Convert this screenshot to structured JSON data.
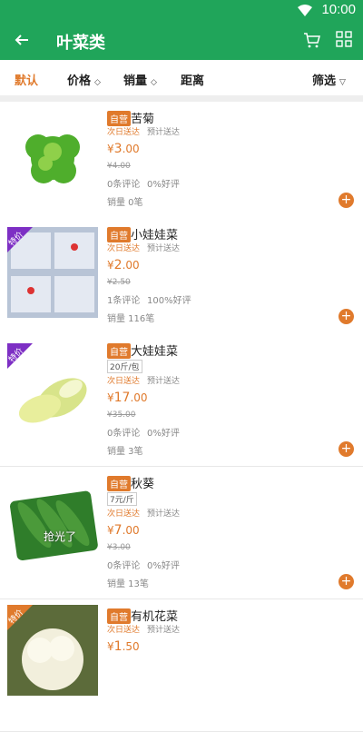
{
  "status": {
    "time": "10:00"
  },
  "header": {
    "title": "叶菜类"
  },
  "filters": {
    "default": "默认",
    "price": "价格",
    "sales": "销量",
    "distance": "距离",
    "filter": "筛选"
  },
  "products": [
    {
      "badge": "自营",
      "name": "苦菊",
      "spec": "",
      "delivery": "次日送达",
      "ship": "预计送达",
      "currency": "¥",
      "price_int": "3",
      "price_dec": ".00",
      "orig": "¥4.00",
      "comments": "0条评论",
      "good": "0%好评",
      "sold": "销量 0笔",
      "tag": "",
      "soldout": ""
    },
    {
      "badge": "自营",
      "name": "小娃娃菜",
      "spec": "",
      "delivery": "次日送达",
      "ship": "预计送达",
      "currency": "¥",
      "price_int": "2",
      "price_dec": ".00",
      "orig": "¥2.50",
      "comments": "1条评论",
      "good": "100%好评",
      "sold": "销量 116笔",
      "tag": "特价",
      "soldout": ""
    },
    {
      "badge": "自营",
      "name": "大娃娃菜",
      "spec": "20斤/包",
      "delivery": "次日送达",
      "ship": "预计送达",
      "currency": "¥",
      "price_int": "17",
      "price_dec": ".00",
      "orig": "¥35.00",
      "comments": "0条评论",
      "good": "0%好评",
      "sold": "销量 3笔",
      "tag": "特价",
      "soldout": ""
    },
    {
      "badge": "自营",
      "name": "秋葵",
      "spec": "7元/斤",
      "delivery": "次日送达",
      "ship": "预计送达",
      "currency": "¥",
      "price_int": "7",
      "price_dec": ".00",
      "orig": "¥3.00",
      "comments": "0条评论",
      "good": "0%好评",
      "sold": "销量 13笔",
      "tag": "",
      "soldout": "抢光了"
    },
    {
      "badge": "自营",
      "name": "有机花菜",
      "spec": "",
      "delivery": "次日送达",
      "ship": "预计送达",
      "currency": "¥",
      "price_int": "1",
      "price_dec": ".50",
      "orig": "",
      "comments": "",
      "good": "",
      "sold": "",
      "tag": "特价",
      "soldout": ""
    }
  ],
  "colors": {
    "green": "#20a55a",
    "orange": "#e07a2c",
    "purple": "#7d2fc4"
  }
}
